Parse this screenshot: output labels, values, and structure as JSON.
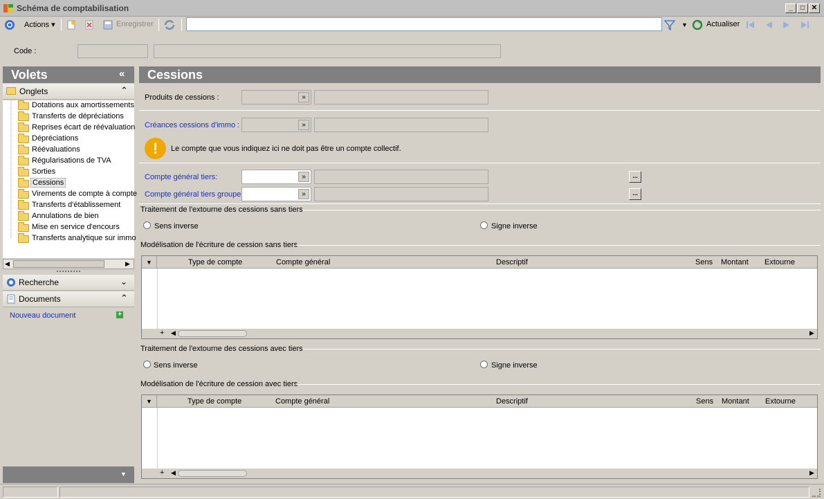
{
  "window": {
    "title": "Schéma de comptabilisation"
  },
  "toolbar": {
    "actions_label": "Actions",
    "save_label": "Enregistrer",
    "search_value": "",
    "refresh_label": "Actualiser"
  },
  "code_row": {
    "label": "Code :",
    "code_value": "",
    "description_value": ""
  },
  "left_panel": {
    "title": "Volets",
    "onglets_label": "Onglets",
    "tree_items": [
      "Dotations aux amortissements",
      "Transferts de dépréciations",
      "Reprises écart de réévaluation",
      "Dépréciations",
      "Réévaluations",
      "Régularisations de TVA",
      "Sorties",
      "Cessions",
      "Virements de compte à compte",
      "Transferts d'établissement",
      "Annulations de bien",
      "Mise en service d'encours",
      "Transferts analytique sur immo"
    ],
    "selected_item": "Cessions",
    "recherche_label": "Recherche",
    "documents_label": "Documents",
    "new_document_label": "Nouveau document"
  },
  "main": {
    "title": "Cessions",
    "produits_label": "Produits de cessions :",
    "creances_label": "Créances cessions d'immo :",
    "warning_text": "Le compte que vous indiquez ici ne doit pas être un compte collectif.",
    "compte_tiers_label": "Compte général tiers:",
    "compte_tiers_groupe_label": "Compte général tiers groupe:",
    "dots_label": "...",
    "sans_tiers": {
      "group_title": "Traitement de l'extourne des cessions sans tiers",
      "option1": "Sens inverse",
      "option2": "Signe inverse",
      "grid_title": "Modélisation de l'écriture de cession sans tiers"
    },
    "avec_tiers": {
      "group_title": "Traitement de l'extourne des cessions avec tiers",
      "option1": "Sens inverse",
      "option2": "Signe inverse",
      "grid_title": "Modélisation de l'écriture de cession avec tiers"
    },
    "grid_columns": [
      "Type de compte",
      "Compte général",
      "Descriptif",
      "Sens",
      "Montant",
      "Extourne"
    ],
    "add_row_symbol": "+"
  },
  "colors": {
    "panel_header": "#808080",
    "link": "#1530c8",
    "warning": "#f0a800"
  }
}
